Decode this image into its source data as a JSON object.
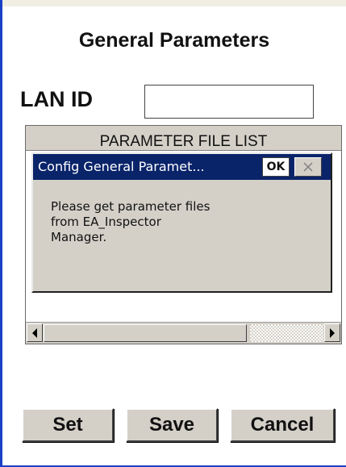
{
  "page": {
    "title": "General Parameters"
  },
  "lan_id": {
    "label": "LAN ID",
    "value": ""
  },
  "parameter_list": {
    "header": "PARAMETER FILE LIST",
    "items": []
  },
  "dialog": {
    "title": "Config General Paramet...",
    "ok_label": "OK",
    "close_icon": "close-icon",
    "message": "Please get parameter files\nfrom EA_Inspector\nManager."
  },
  "buttons": {
    "set_label": "Set",
    "save_label": "Save",
    "cancel_label": "Cancel"
  },
  "colors": {
    "window_border": "#1a40c8",
    "dialog_title_bar": "#0a246a",
    "control_face": "#d4d0c8"
  }
}
